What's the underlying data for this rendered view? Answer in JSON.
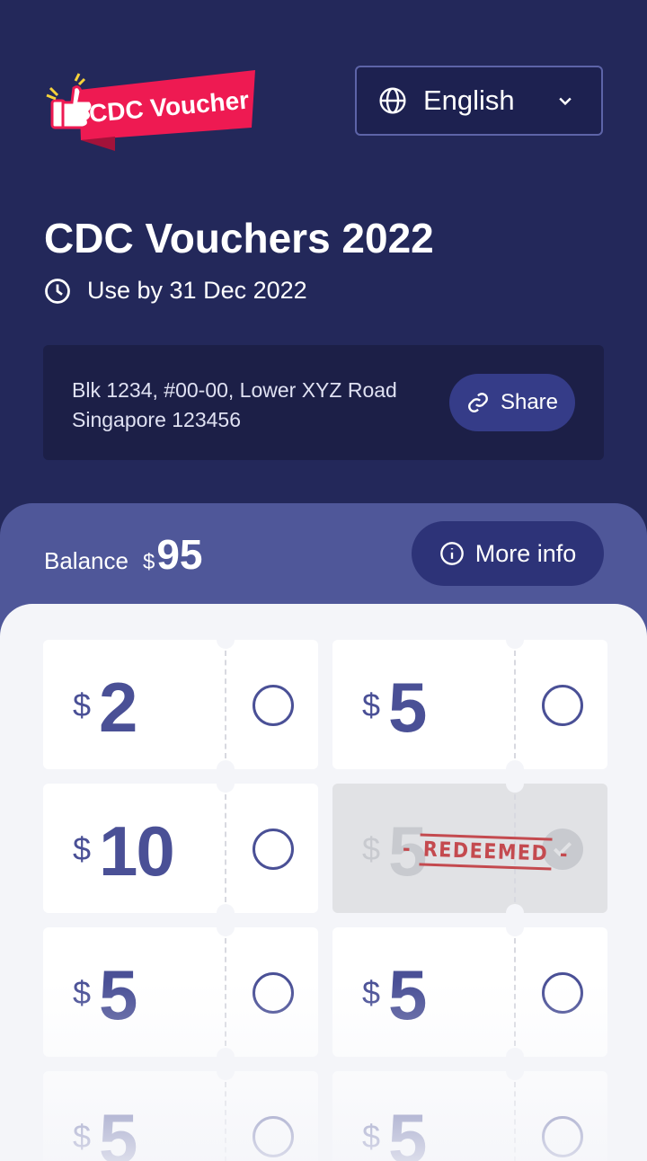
{
  "header": {
    "logo_text": "CDC Voucher",
    "language": "English"
  },
  "title": "CDC Vouchers 2022",
  "use_by": "Use by 31 Dec 2022",
  "address": "Blk 1234, #00-00, Lower XYZ Road Singapore 123456",
  "share_label": "Share",
  "balance": {
    "label": "Balance",
    "currency": "$",
    "amount": "95"
  },
  "more_info_label": "More info",
  "vouchers": [
    {
      "currency": "$",
      "value": "2",
      "redeemed": false
    },
    {
      "currency": "$",
      "value": "5",
      "redeemed": false
    },
    {
      "currency": "$",
      "value": "10",
      "redeemed": false
    },
    {
      "currency": "$",
      "value": "5",
      "redeemed": true,
      "stamp": "REDEEMED"
    },
    {
      "currency": "$",
      "value": "5",
      "redeemed": false
    },
    {
      "currency": "$",
      "value": "5",
      "redeemed": false
    },
    {
      "currency": "$",
      "value": "5",
      "redeemed": false
    },
    {
      "currency": "$",
      "value": "5",
      "redeemed": false
    }
  ],
  "colors": {
    "bg": "#23285a",
    "band": "#4f5799",
    "accent": "#4a5096",
    "stamp": "#c44a4f",
    "logo": "#ee1a52"
  }
}
